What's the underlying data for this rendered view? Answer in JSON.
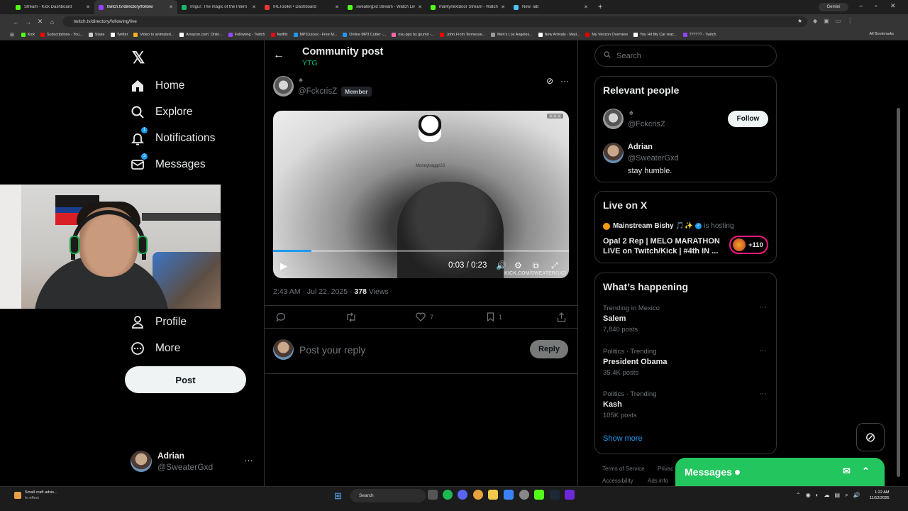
{
  "browser": {
    "tabs": [
      {
        "label": "Stream - Kick Dashboard",
        "color": "#53fc18"
      },
      {
        "label": "twitch.tv/directory/followi",
        "color": "#9146ff",
        "active": true
      },
      {
        "label": "Imgur: The magic of the Intern",
        "color": "#1bb76e"
      },
      {
        "label": "IRLToolkit • Dashboard",
        "color": "#e53935"
      },
      {
        "label": "sweatergxd Stream - Watch Liv",
        "color": "#53fc18"
      },
      {
        "label": "markynextdoor Stream - Watch",
        "color": "#53fc18"
      },
      {
        "label": "New Tab",
        "color": "#4fc3f7"
      }
    ],
    "gemini_label": "Gemini",
    "url": "twitch.tv/directory/following/live",
    "bookmarks": [
      {
        "label": "Kick",
        "color": "#53fc18"
      },
      {
        "label": "Subscriptions - You...",
        "color": "#ff0000"
      },
      {
        "label": "Stake",
        "color": "#cccccc"
      },
      {
        "label": "Twitter",
        "color": "#ffffff"
      },
      {
        "label": "Video to animated...",
        "color": "#f2b01e"
      },
      {
        "label": "Amazon.com: Onlin...",
        "color": "#ffffff"
      },
      {
        "label": "Following - Twitch",
        "color": "#9146ff"
      },
      {
        "label": "Netflix",
        "color": "#e50914"
      },
      {
        "label": "MP3Juices - Free M...",
        "color": "#2196f3"
      },
      {
        "label": "Online MP3 Cutter -...",
        "color": "#2196f3"
      },
      {
        "label": "osu-pps by grumd -...",
        "color": "#ff66aa"
      },
      {
        "label": "John From Tennesse...",
        "color": "#ff0000"
      },
      {
        "label": "Men's Los Angeles...",
        "color": "#999999"
      },
      {
        "label": "New Arrivals - Mad...",
        "color": "#ffffff"
      },
      {
        "label": "My Verizon Overview",
        "color": "#e00000"
      },
      {
        "label": "You Hit My Car reac...",
        "color": "#ffffff"
      },
      {
        "label": "?????? - Twitch",
        "color": "#9146ff"
      }
    ],
    "all_bookmarks": "All Bookmarks"
  },
  "nav": {
    "home": "Home",
    "explore": "Explore",
    "notifications": "Notifications",
    "notifications_badge": "1",
    "messages": "Messages",
    "messages_badge": "3",
    "profile": "Profile",
    "more": "More",
    "post_button": "Post"
  },
  "account": {
    "name": "Adrian",
    "handle": "@SweaterGxd"
  },
  "post": {
    "title": "Community post",
    "community": "YTG",
    "author_handle": "@FckcrisZ",
    "member_badge": "Member",
    "video": {
      "overlay_name": "Moneybaggz23",
      "watermark": "KICK.COM/SWEATERGXD",
      "time": "0:03 / 0:23",
      "progress_fraction": 0.13
    },
    "timestamp": "2:43 AM · Jul 22, 2025 · ",
    "views_count": "378",
    "views_label": " Views",
    "likes": "7",
    "bookmarks": "1",
    "reply_placeholder": "Post your reply",
    "reply_button": "Reply"
  },
  "sidebar": {
    "search_placeholder": "Search",
    "relevant_people": {
      "heading": "Relevant people",
      "person1_handle": "@FckcrisZ",
      "follow_button": "Follow",
      "person2_name": "Adrian",
      "person2_handle": "@SweaterGxd",
      "person2_bio": "stay humble."
    },
    "live": {
      "heading": "Live on X",
      "host_name": "Mainstream Bishy 🎵✨",
      "hosting_text": "is hosting",
      "title": "Opal 2 Rep | MELO MARATHON LIVE on Twitch/Kick | #4th IN ...",
      "listeners": "+110"
    },
    "happening": {
      "heading": "What’s happening",
      "trends": [
        {
          "context": "Trending in Mexico",
          "name": "Salem",
          "posts": "7,840 posts"
        },
        {
          "context": "Politics · Trending",
          "name": "President Obama",
          "posts": "35.4K posts"
        },
        {
          "context": "Politics · Trending",
          "name": "Kash",
          "posts": "105K posts"
        }
      ],
      "show_more": "Show more"
    },
    "footer": {
      "terms": "Terms of Service",
      "privacy": "Privac",
      "accessibility": "Accessibility",
      "ads": "Ads info"
    }
  },
  "messages_drawer": {
    "label": "Messages"
  },
  "taskbar": {
    "weather_line1": "Small craft advis...",
    "weather_line2": "In effect",
    "search": "Search",
    "time": "1:22 AM",
    "date": "11/12/2025"
  }
}
